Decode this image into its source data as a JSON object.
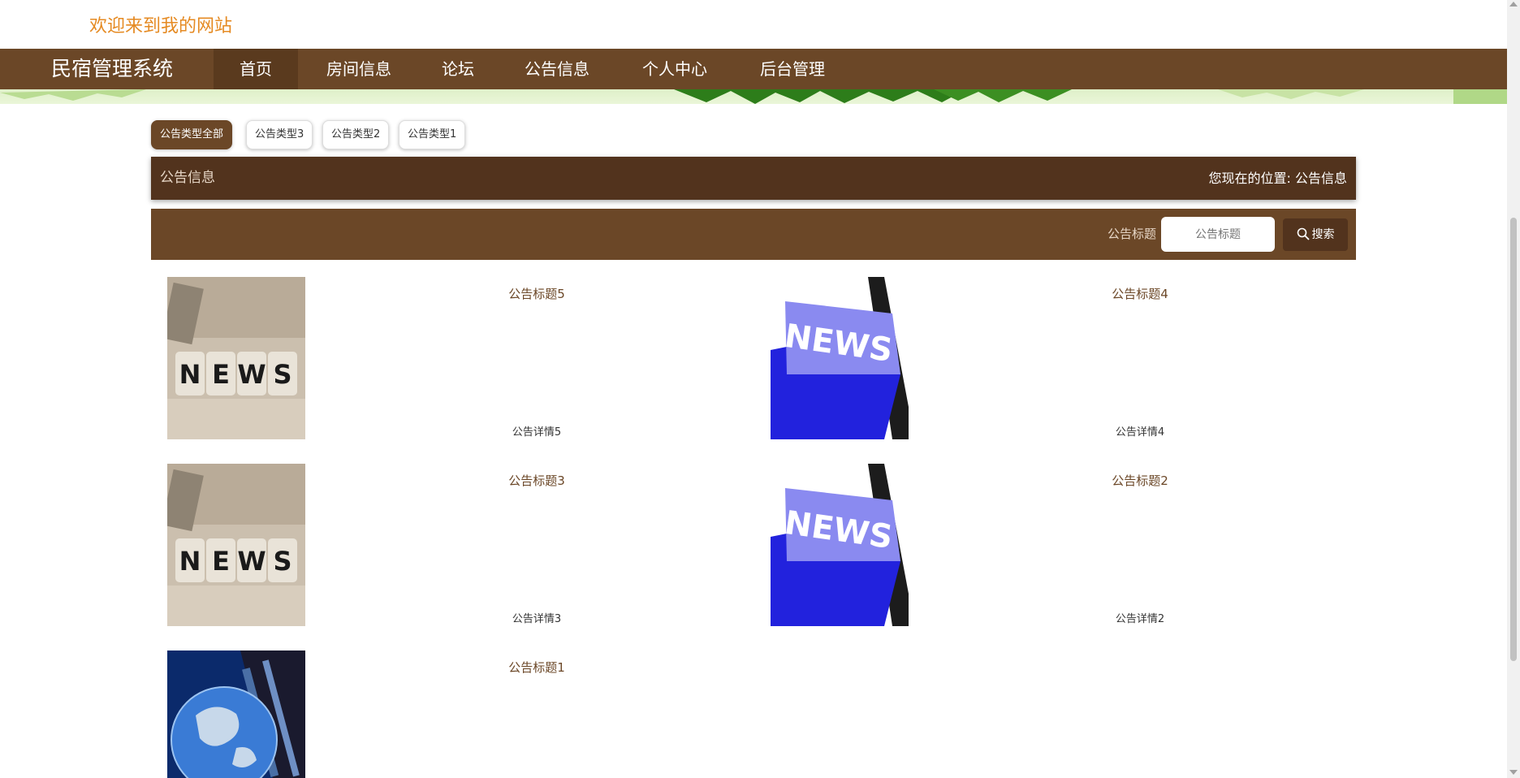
{
  "header": {
    "welcome": "欢迎来到我的网站"
  },
  "nav": {
    "brand": "民宿管理系统",
    "items": [
      {
        "label": "首页"
      },
      {
        "label": "房间信息"
      },
      {
        "label": "论坛"
      },
      {
        "label": "公告信息"
      },
      {
        "label": "个人中心"
      },
      {
        "label": "后台管理"
      }
    ]
  },
  "types": [
    {
      "label": "公告类型全部"
    },
    {
      "label": "公告类型3"
    },
    {
      "label": "公告类型2"
    },
    {
      "label": "公告类型1"
    }
  ],
  "crumb": {
    "title": "公告信息",
    "position": "您现在的位置: 公告信息"
  },
  "search": {
    "label": "公告标题",
    "placeholder": "公告标题",
    "button": "搜索"
  },
  "notices": [
    {
      "title": "公告标题5",
      "detail": "公告详情5",
      "image": "news-dice"
    },
    {
      "title": "公告标题4",
      "detail": "公告详情4",
      "image": "news-key"
    },
    {
      "title": "公告标题3",
      "detail": "公告详情3",
      "image": "news-dice"
    },
    {
      "title": "公告标题2",
      "detail": "公告详情2",
      "image": "news-key"
    },
    {
      "title": "公告标题1",
      "detail": "",
      "image": "globe"
    }
  ],
  "colors": {
    "brown": "#6b4727",
    "dark_brown": "#52331d",
    "welcome": "#e58a22"
  }
}
